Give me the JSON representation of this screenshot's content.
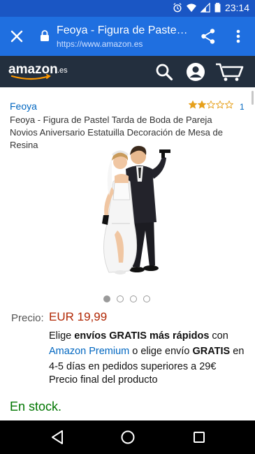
{
  "status_bar": {
    "time": "23:14"
  },
  "browser": {
    "title": "Feoya - Figura de Pastel Tard...",
    "url": "https://www.amazon.es",
    "icons": [
      "close-icon",
      "lock-icon",
      "share-icon",
      "more-vert-icon"
    ]
  },
  "amazon_header": {
    "logo_text": "amazon",
    "logo_suffix": ".es",
    "icons": [
      "search-icon",
      "account-icon",
      "cart-icon"
    ]
  },
  "product": {
    "brand": "Feoya",
    "rating_stars": 2,
    "rating_max": 5,
    "rating_count": "1",
    "title": "Feoya - Figura de Pastel Tarda de Boda de Pareja Novios Aniversario Estatuilla Decoración de Mesa de Resina",
    "image_count": 4,
    "active_image": 1,
    "price_label": "Precio:",
    "price": "EUR 19,99",
    "shipping": {
      "part1": "Elige ",
      "bold1": "envíos GRATIS más rápidos",
      "part2": " con ",
      "link": "Amazon Premium",
      "part3": " o elige envío ",
      "bold2": "GRATIS",
      "part4": " en 4-5 días en pedidos superiores a 29€"
    },
    "final_price_note": "Precio final del producto",
    "stock": "En stock."
  },
  "colors": {
    "status_bar": "#1a56c4",
    "chrome_toolbar": "#1f6fe0",
    "amazon_header": "#232f3e",
    "link": "#0066c0",
    "price": "#b12704",
    "stock": "#007600",
    "star": "#e6a01b"
  }
}
